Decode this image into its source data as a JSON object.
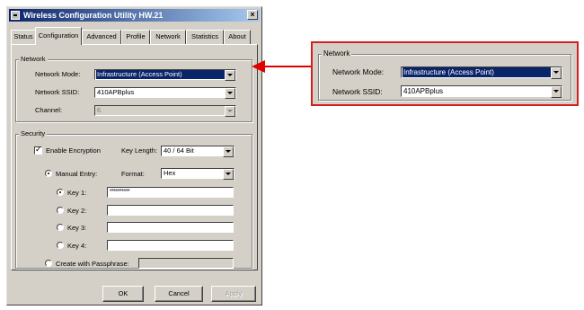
{
  "window": {
    "title": "Wireless Configuration Utility HW.21",
    "close_glyph": "×"
  },
  "tabs": [
    "Status",
    "Configuration",
    "Advanced",
    "Profile",
    "Network",
    "Statistics",
    "About"
  ],
  "network": {
    "legend": "Network",
    "mode_label": "Network Mode:",
    "mode_value": "Infrastructure (Access Point)",
    "ssid_label": "Network SSID:",
    "ssid_value": "410APBplus",
    "channel_label": "Channel:",
    "channel_value": "6"
  },
  "security": {
    "legend": "Security",
    "enable_label": "Enable Encryption",
    "enable_checked": true,
    "check_glyph": "✓",
    "key_length_label": "Key Length:",
    "key_length_value": "40 / 64 Bit",
    "manual_label": "Manual Entry:",
    "format_label": "Format:",
    "format_value": "Hex",
    "key1_label": "Key 1:",
    "key1_value": "**********",
    "key2_label": "Key 2:",
    "key3_label": "Key 3:",
    "key4_label": "Key 4:",
    "passphrase_label": "Create with Passphrase:"
  },
  "buttons": {
    "ok": "OK",
    "cancel": "Cancel",
    "apply": "Apply"
  },
  "callout": {
    "legend": "Network",
    "mode_label": "Network Mode:",
    "mode_value": "Infrastructure (Access Point)",
    "ssid_label": "Network SSID:",
    "ssid_value": "410APBplus",
    "border_color": "#d02020"
  }
}
